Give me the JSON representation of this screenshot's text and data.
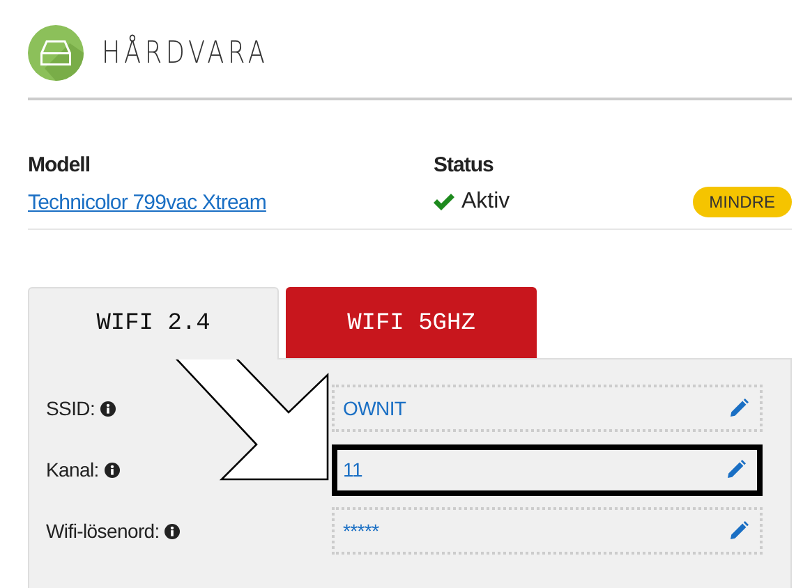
{
  "header": {
    "title": "HÅRDVARA"
  },
  "device": {
    "columns": [
      "Modell",
      "Status"
    ],
    "model": "Technicolor 799vac Xtream",
    "status": {
      "text": "Aktiv",
      "active": true
    },
    "toggle_button": "MINDRE"
  },
  "tabs": [
    {
      "label": "WIFI 2.4",
      "selected": true
    },
    {
      "label": "WIFI 5GHZ",
      "selected": false
    }
  ],
  "settings": [
    {
      "label": "SSID:",
      "value": "OWNIT",
      "highlighted": false
    },
    {
      "label": "Kanal:",
      "value": "11",
      "highlighted": true
    },
    {
      "label": "Wifi-lösenord:",
      "value": "*****",
      "highlighted": false
    }
  ]
}
